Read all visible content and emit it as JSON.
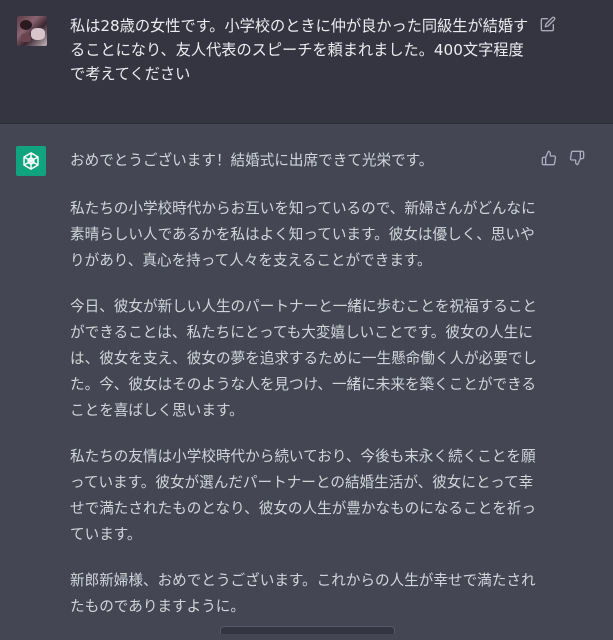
{
  "user": {
    "avatar_icon": "user-avatar-photo",
    "message": "私は28歳の女性です。小学校のときに仲が良かった同級生が結婚することになり、友人代表のスピーチを頼まれました。400文字程度で考えてください",
    "edit_icon": "edit-pencil-icon"
  },
  "assistant": {
    "avatar_icon": "openai-logo-icon",
    "paragraphs": [
      "おめでとうございます！結婚式に出席できて光栄です。",
      "私たちの小学校時代からお互いを知っているので、新婦さんがどんなに素晴らしい人であるかを私はよく知っています。彼女は優しく、思いやりがあり、真心を持って人々を支えることができます。",
      "今日、彼女が新しい人生のパートナーと一緒に歩むことを祝福することができることは、私たちにとっても大変嬉しいことです。彼女の人生には、彼女を支え、彼女の夢を追求するために一生懸命働く人が必要でした。今、彼女はそのような人を見つけ、一緒に未来を築くことができることを喜ばしく思います。",
      "私たちの友情は小学校時代から続いており、今後も末永く続くことを願っています。彼女が選んだパートナーとの結婚生活が、彼女にとって幸せで満たされたものとなり、彼女の人生が豊かなものになることを祈っています。",
      "新郎新婦様、おめでとうございます。これからの人生が幸せで満たされたものでありますように。"
    ],
    "thumbs_up_icon": "thumbs-up-icon",
    "thumbs_down_icon": "thumbs-down-icon"
  },
  "colors": {
    "user_bg": "#343541",
    "assistant_bg": "#444654",
    "accent": "#10a37f"
  }
}
